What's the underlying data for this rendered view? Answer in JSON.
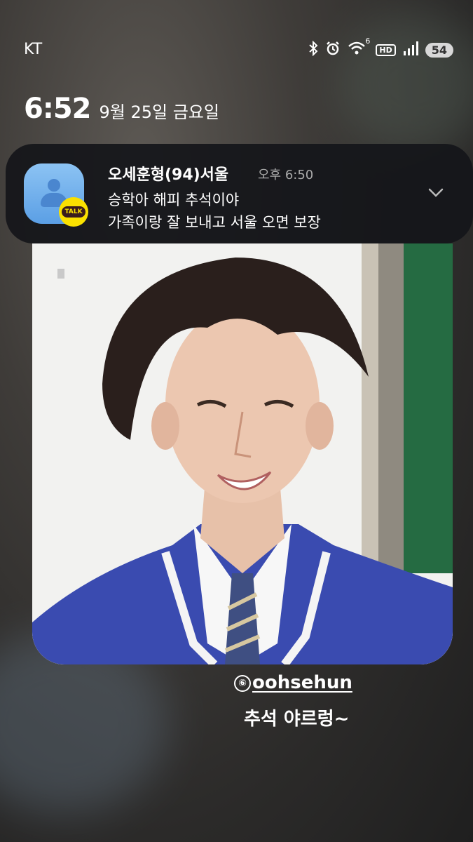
{
  "status_bar": {
    "carrier": "KT",
    "wifi_badge": "6",
    "hd_label": "HD",
    "battery": "54"
  },
  "lock_screen": {
    "time": "6:52",
    "date": "9월 25일 금요일"
  },
  "notification": {
    "app_icon": "kakaotalk-icon",
    "talk_label": "TALK",
    "sender": "오세훈형(94)서울",
    "time": "오후 6:50",
    "line1": "승학아 해피 추석이야",
    "line2": "가족이랑 잘 보내고 서울 오면 보장"
  },
  "story": {
    "mention_mark": "⑥",
    "mention": "oohsehun",
    "caption": "추석 야르렁~"
  },
  "colors": {
    "notification_bg": "#14161a",
    "kakao_yellow": "#fae100",
    "uniform_blue": "#3a4bb0"
  }
}
